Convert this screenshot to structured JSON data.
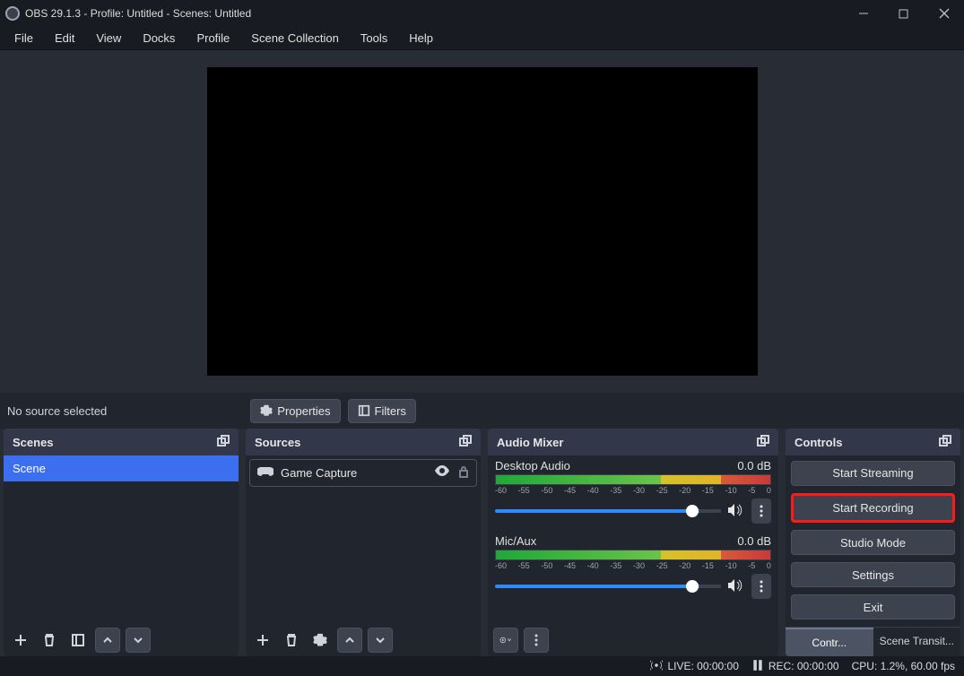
{
  "titlebar": {
    "text": "OBS 29.1.3 - Profile: Untitled - Scenes: Untitled"
  },
  "menubar": {
    "items": [
      "File",
      "Edit",
      "View",
      "Docks",
      "Profile",
      "Scene Collection",
      "Tools",
      "Help"
    ]
  },
  "sourcebar": {
    "status": "No source selected",
    "properties": "Properties",
    "filters": "Filters"
  },
  "scenes": {
    "title": "Scenes",
    "items": [
      "Scene"
    ]
  },
  "sources": {
    "title": "Sources",
    "items": [
      {
        "name": "Game Capture"
      }
    ]
  },
  "mixer": {
    "title": "Audio Mixer",
    "ticks": [
      "-60",
      "-55",
      "-50",
      "-45",
      "-40",
      "-35",
      "-30",
      "-25",
      "-20",
      "-15",
      "-10",
      "-5",
      "0"
    ],
    "channels": [
      {
        "name": "Desktop Audio",
        "db": "0.0 dB"
      },
      {
        "name": "Mic/Aux",
        "db": "0.0 dB"
      }
    ]
  },
  "controls": {
    "title": "Controls",
    "buttons": {
      "start_streaming": "Start Streaming",
      "start_recording": "Start Recording",
      "studio_mode": "Studio Mode",
      "settings": "Settings",
      "exit": "Exit"
    },
    "tabs": {
      "contr": "Contr...",
      "scene_transit": "Scene Transit..."
    }
  },
  "statusbar": {
    "live": "LIVE: 00:00:00",
    "rec": "REC: 00:00:00",
    "cpu": "CPU: 1.2%, 60.00 fps"
  }
}
